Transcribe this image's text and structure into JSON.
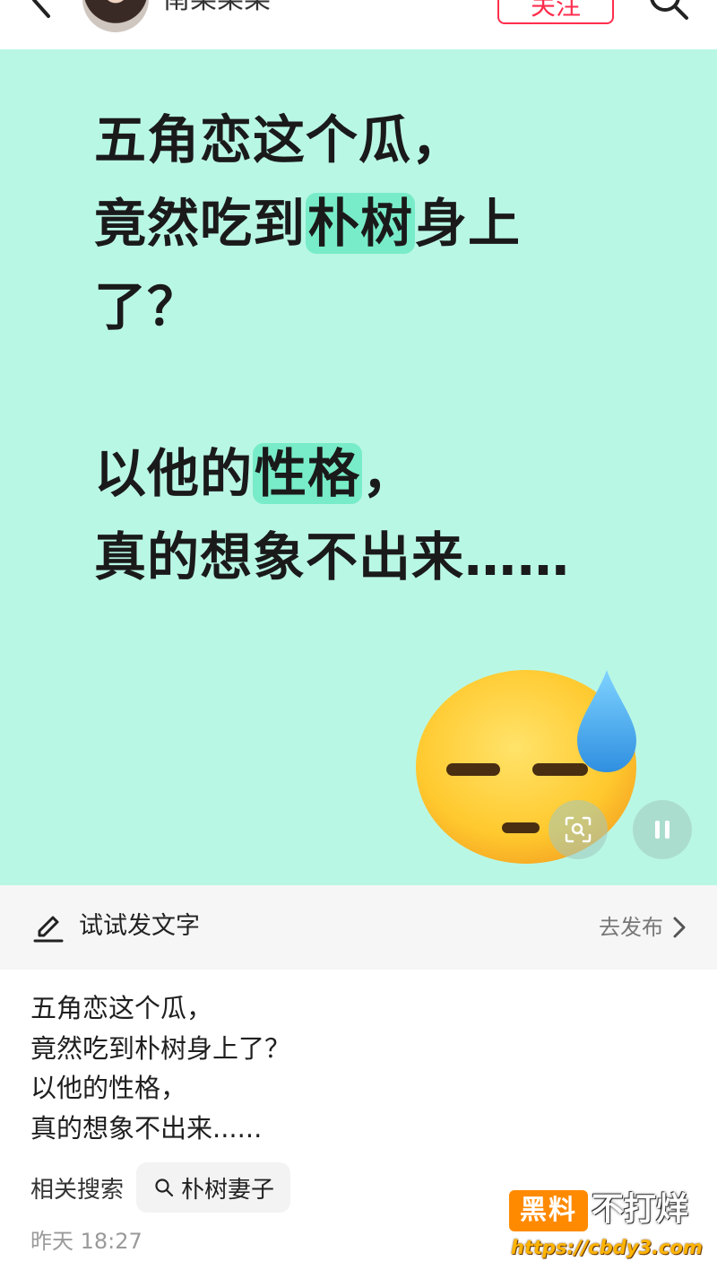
{
  "header": {
    "username": "南栗栗栗",
    "follow_label": "关注",
    "icons": [
      "back-arrow-icon",
      "avatar",
      "search-icon"
    ]
  },
  "cover": {
    "lines": [
      {
        "before": "五角恋这个瓜，",
        "highlight": "",
        "after": ""
      },
      {
        "before": "竟然吃到",
        "highlight": "朴树",
        "after": "身上"
      },
      {
        "before": "了？",
        "highlight": "",
        "after": ""
      },
      {
        "before": "以他的",
        "highlight": "性格",
        "after": "，"
      },
      {
        "before": "真的想象不出来……",
        "highlight": "",
        "after": ""
      }
    ],
    "background_color": "#b9f7e5",
    "highlight_color": "#78ecc8",
    "emoji": "downcast-face-with-sweat-icon",
    "controls": [
      "scan-icon",
      "pause-icon"
    ]
  },
  "try_bar": {
    "label": "试试发文字",
    "action": "去发布"
  },
  "post": {
    "lines": [
      "五角恋这个瓜，",
      "竟然吃到朴树身上了？",
      "以他的性格，",
      "真的想象不出来......"
    ],
    "related_label": "相关搜索",
    "related_query": "朴树妻子",
    "time": "昨天 18:27"
  },
  "watermark": {
    "badge": "黑料",
    "text": "不打烊",
    "url": "https://cbdy3.com"
  },
  "colors": {
    "accent": "#ff2e4d",
    "watermark_orange": "#ff8a00"
  }
}
